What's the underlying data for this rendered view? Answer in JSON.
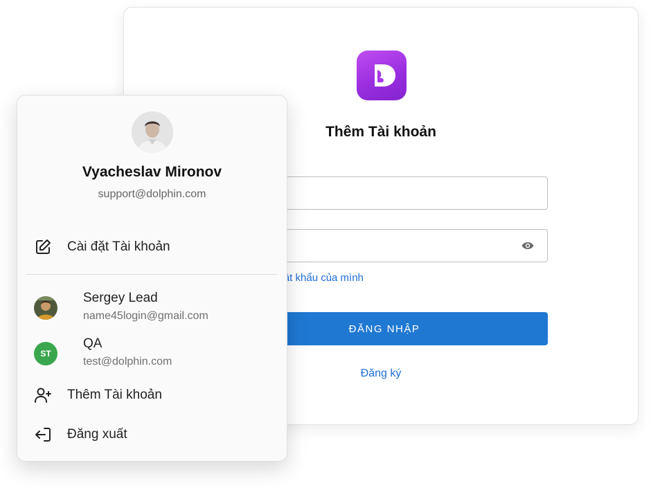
{
  "login": {
    "title": "Thêm Tài khoản",
    "forgot_link": "ı mật khẩu của mình",
    "login_button": "ĐĂNG NHẬP",
    "register_link": "Đăng ký",
    "logo_icon": "dolphin-logo",
    "brand_color": "#9a2ee0",
    "button_color": "#1f78d1",
    "link_color": "#1e6ed6"
  },
  "menu": {
    "user": {
      "name": "Vyacheslav Mironov",
      "email": "support@dolphin.com"
    },
    "settings_label": "Cài đặt Tài khoản",
    "accounts": [
      {
        "name": "Sergey Lead",
        "email": "name45login@gmail.com"
      },
      {
        "name": "QA",
        "email": "test@dolphin.com",
        "initials": "ST",
        "badge_color": "#3aa64e"
      }
    ],
    "add_account_label": "Thêm Tài khoản",
    "logout_label": "Đăng xuất"
  }
}
